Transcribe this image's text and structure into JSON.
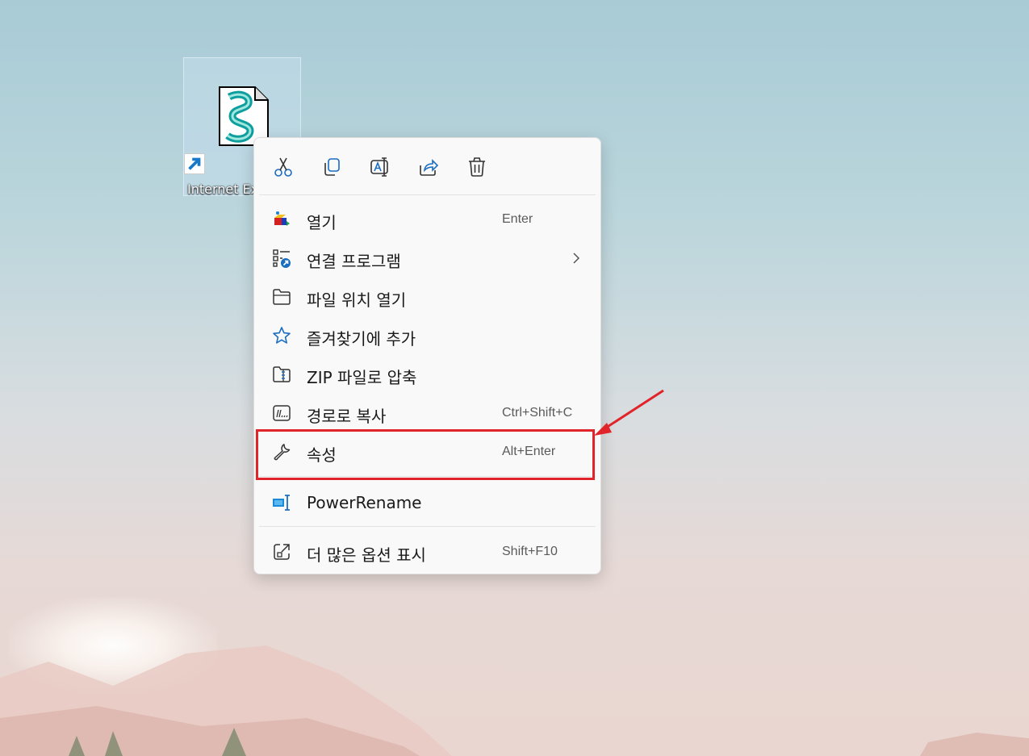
{
  "desktop": {
    "icon_label": "Internet Ex"
  },
  "toolbar": {
    "cut": "scissors-icon",
    "copy": "copy-icon",
    "rename": "rename-icon",
    "share": "share-icon",
    "delete": "trash-icon"
  },
  "menu": {
    "items": [
      {
        "label": "열기",
        "shortcut": "Enter",
        "icon": "open-app-icon"
      },
      {
        "label": "연결 프로그램",
        "shortcut": "",
        "icon": "open-with-icon"
      },
      {
        "label": "파일 위치 열기",
        "shortcut": "",
        "icon": "folder-icon"
      },
      {
        "label": "즐겨찾기에 추가",
        "shortcut": "",
        "icon": "star-icon"
      },
      {
        "label": "ZIP 파일로 압축",
        "shortcut": "",
        "icon": "zip-folder-icon"
      },
      {
        "label": "경로로 복사",
        "shortcut": "Ctrl+Shift+C",
        "icon": "copy-path-icon"
      },
      {
        "label": "속성",
        "shortcut": "Alt+Enter",
        "icon": "wrench-icon"
      },
      {
        "label": "PowerRename",
        "shortcut": "",
        "icon": "powerrename-icon"
      },
      {
        "label": "더 많은 옵션 표시",
        "shortcut": "Shift+F10",
        "icon": "more-options-icon"
      }
    ]
  },
  "colors": {
    "highlight": "#e0242a",
    "accent": "#0067c0"
  }
}
